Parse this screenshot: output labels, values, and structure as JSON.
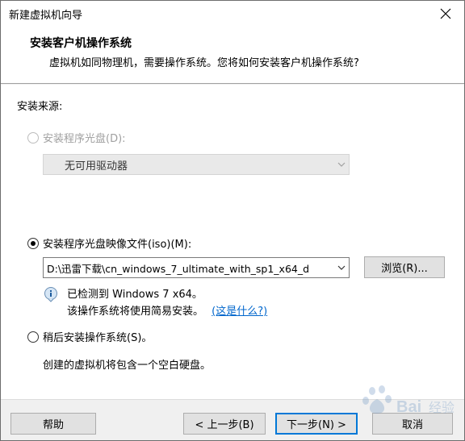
{
  "window": {
    "title": "新建虚拟机向导"
  },
  "header": {
    "title": "安装客户机操作系统",
    "subtitle": "虚拟机如同物理机，需要操作系统。您将如何安装客户机操作系统?"
  },
  "source": {
    "group_label": "安装来源:",
    "disc_option": {
      "label": "安装程序光盘(D):",
      "selected": false,
      "disabled": true
    },
    "disc_combo": {
      "value": "无可用驱动器"
    },
    "iso_option": {
      "label": "安装程序光盘映像文件(iso)(M):",
      "selected": true
    },
    "iso_combo": {
      "value": "D:\\迅雷下载\\cn_windows_7_ultimate_with_sp1_x64_d"
    },
    "browse_button": "浏览(R)...",
    "detected_text": "已检测到 Windows 7 x64。",
    "easy_install_text": "该操作系统将使用简易安装。",
    "whats_this_link": "(这是什么?)",
    "later_option": {
      "label": "稍后安装操作系统(S)。",
      "selected": false
    },
    "later_desc": "创建的虚拟机将包含一个空白硬盘。"
  },
  "footer": {
    "help_button": "帮助",
    "back_button": "< 上一步(B)",
    "next_button": "下一步(N) >",
    "cancel_button": "取消"
  },
  "watermark": {
    "text": "Bai 经验"
  }
}
